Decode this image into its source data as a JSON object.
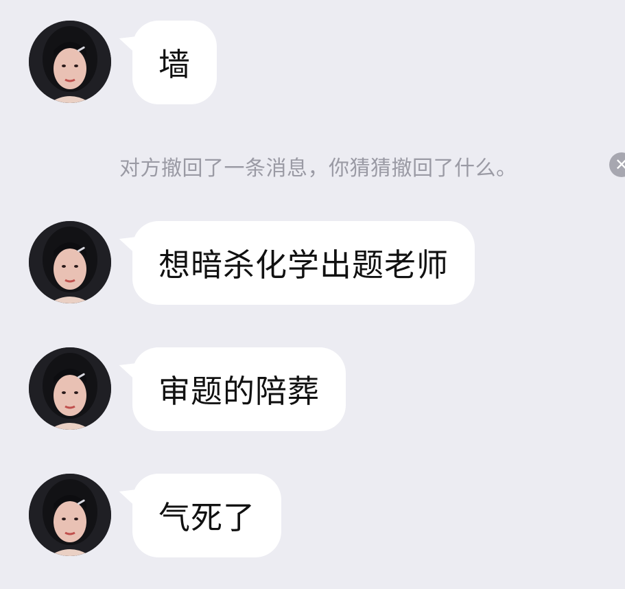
{
  "chat": {
    "messages": [
      {
        "text": "墙"
      },
      {
        "text": "想暗杀化学出题老师"
      },
      {
        "text": "审题的陪葬"
      },
      {
        "text": "气死了"
      }
    ],
    "system_notice": "对方撤回了一条消息，你猜猜撤回了什么。",
    "close_icon_glyph": "✕"
  },
  "colors": {
    "background": "#ececf2",
    "bubble": "#ffffff",
    "text": "#111111",
    "system_text": "#9a9aa4"
  }
}
